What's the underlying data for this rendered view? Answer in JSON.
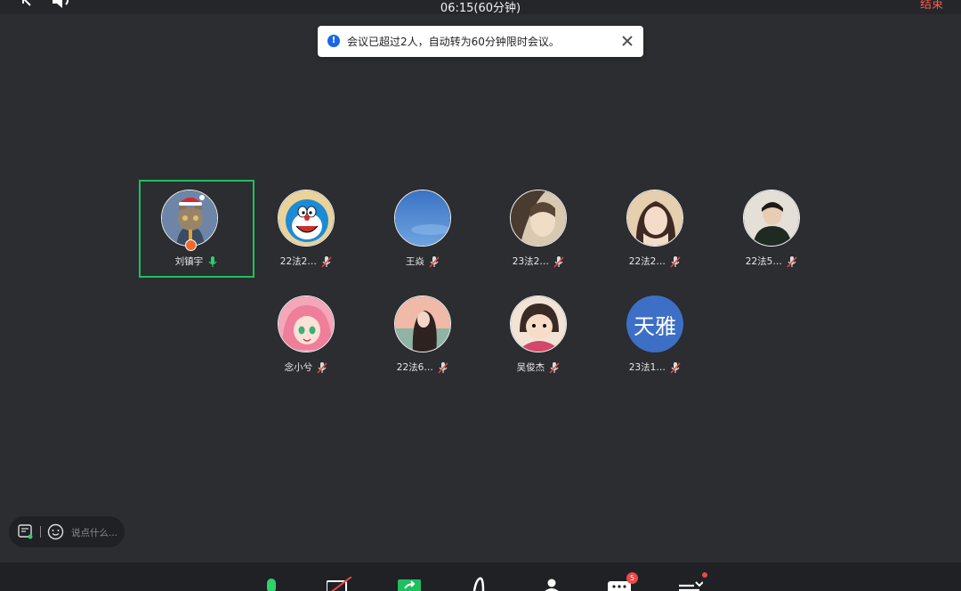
{
  "topbar": {
    "time": "06:15(60分钟)",
    "end_label": "结束"
  },
  "toast": {
    "message": "会议已超过2人，自动转为60分钟限时会议。"
  },
  "participants": [
    {
      "name": "刘镇宇",
      "mic": "on",
      "host": true,
      "active": true,
      "avatar": "cat-with-santa-hat"
    },
    {
      "name": "22法2…",
      "mic": "muted",
      "avatar": "doraemon"
    },
    {
      "name": "王焱",
      "mic": "muted",
      "avatar": "blue-sky"
    },
    {
      "name": "23法2…",
      "mic": "muted",
      "avatar": "photo-portrait"
    },
    {
      "name": "22法2…",
      "mic": "muted",
      "avatar": "photo-portrait"
    },
    {
      "name": "22法5…",
      "mic": "muted",
      "avatar": "photo-portrait"
    },
    {
      "name": "念小兮",
      "mic": "muted",
      "avatar": "anime-pink-hair"
    },
    {
      "name": "22法6…",
      "mic": "muted",
      "avatar": "illustration"
    },
    {
      "name": "吴俊杰",
      "mic": "muted",
      "avatar": "cartoon"
    },
    {
      "name": "23法1…",
      "mic": "muted",
      "avatar_text": "天雅",
      "avatar_color": "#3d6fc6"
    }
  ],
  "chat": {
    "placeholder": "说点什么..."
  },
  "toolbar": {
    "chat_badge": "5"
  },
  "colors": {
    "background": "#2b2d31",
    "active_border": "#1fbe5f",
    "mic_on": "#2fd16b",
    "end_red": "#ff5a4e"
  }
}
